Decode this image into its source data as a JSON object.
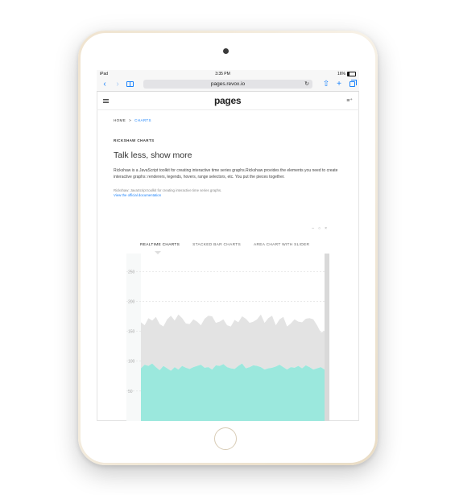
{
  "device": {
    "status_left": "iPad",
    "time": "3:35 PM",
    "battery": "16%"
  },
  "browser": {
    "url": "pages.revox.io"
  },
  "site": {
    "brand": "pages"
  },
  "breadcrumb": {
    "home": "HOME",
    "sep": ">",
    "current": "CHARTS"
  },
  "page": {
    "section_label": "RICKSHAW CHARTS",
    "headline": "Talk less, show more",
    "description": "Rickshaw is a JavaScript toolkit for creating interactive time series graphs.Rickshaw provides the elements you need to create interactive graphs: renderers, legends, hovers, range selectors, etc. You put the pieces together.",
    "note": "Rickshaw: JavaScript toolkit for creating interactive time series graphs.",
    "doc_link": "View the official documentation"
  },
  "panel_controls": [
    "–",
    "○",
    "×"
  ],
  "chart_tabs": [
    {
      "label": "REALTIME CHARTS",
      "active": true
    },
    {
      "label": "STACKED BAR CHARTS",
      "active": false
    },
    {
      "label": "AREA CHART WITH SLIDER",
      "active": false
    }
  ],
  "chart_data": {
    "type": "area",
    "ylim": [
      0,
      280
    ],
    "y_ticks": [
      250,
      200,
      150,
      100,
      50
    ],
    "grid": true,
    "colors": {
      "top_series": "#e3e3e3",
      "bottom_series": "#9be8dd",
      "grid": "#dedede",
      "handle": "#d9d9d9"
    },
    "x": [
      0,
      1,
      2,
      3,
      4,
      5,
      6,
      7,
      8,
      9,
      10,
      11,
      12,
      13,
      14,
      15,
      16,
      17,
      18,
      19,
      20,
      21,
      22,
      23,
      24,
      25,
      26,
      27,
      28,
      29,
      30,
      31,
      32,
      33,
      34,
      35,
      36,
      37,
      38,
      39,
      40,
      41,
      42,
      43,
      44,
      45,
      46,
      47,
      48,
      49
    ],
    "series": [
      {
        "values": [
          88,
          94,
          92,
          96,
          90,
          85,
          92,
          88,
          84,
          90,
          86,
          92,
          89,
          87,
          90,
          92,
          94,
          89,
          90,
          86,
          93,
          92,
          95,
          90,
          88,
          87,
          92,
          96,
          88,
          90,
          93,
          92,
          90,
          86,
          88,
          89,
          91,
          94,
          90,
          86,
          90,
          89,
          92,
          88,
          93,
          90,
          86,
          88,
          90,
          86
        ]
      },
      {
        "values": [
          165,
          160,
          172,
          168,
          174,
          162,
          158,
          170,
          176,
          168,
          178,
          172,
          163,
          162,
          170,
          166,
          160,
          171,
          176,
          175,
          164,
          166,
          170,
          160,
          158,
          169,
          165,
          175,
          171,
          164,
          166,
          170,
          178,
          164,
          172,
          176,
          160,
          170,
          174,
          158,
          163,
          170,
          166,
          165,
          171,
          172,
          170,
          160,
          148,
          150
        ]
      }
    ]
  }
}
